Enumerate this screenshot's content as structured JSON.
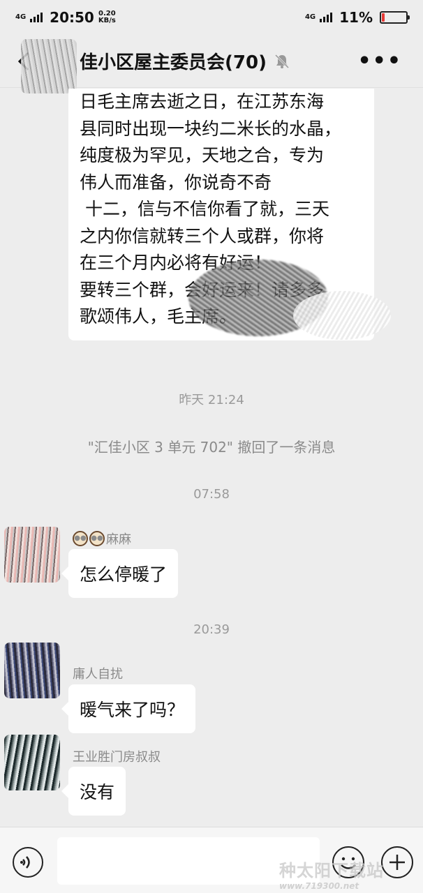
{
  "status_bar": {
    "network_left": "4G",
    "time": "20:50",
    "speed_value": "0.20",
    "speed_unit": "KB/s",
    "network_right": "4G",
    "battery_percent_text": "11%",
    "battery_level": 0.11,
    "battery_color": "#e53935"
  },
  "nav": {
    "title": "佳小区屋主委员会(70)",
    "back_icon": "back-chevron-icon",
    "mute_icon": "bell-muted-icon",
    "more_label": "•••"
  },
  "messages": {
    "long_text": "日毛主席去逝之日，在江苏东海\n县同时出现一块约二米长的水晶，\n纯度极为罕见，天地之合，专为\n伟人而准备，你说奇不奇\n 十二，信与不信你看了就，三天\n之内你信就转三个人或群，你将\n在三个月内必将有好运！\n要转三个群，会好运来！请多多\n歌颂伟人，毛主席。",
    "time_1": "昨天 21:24",
    "recall_notice": "\"汇佳小区 3 单元 702\" 撤回了一条消息",
    "time_2": "07:58",
    "sender_1": "麻麻",
    "msg_1": "怎么停暖了",
    "time_3": "20:39",
    "sender_2": "庸人自扰",
    "msg_2": "暖气来了吗？",
    "sender_3": "王业胜门房叔叔",
    "msg_3": "没有"
  },
  "input_bar": {
    "voice_icon": "voice-icon",
    "emoji_icon": "emoji-icon",
    "plus_icon": "plus-icon"
  },
  "watermark": {
    "title": "种太阳下载站",
    "url": "www.719300.net"
  }
}
